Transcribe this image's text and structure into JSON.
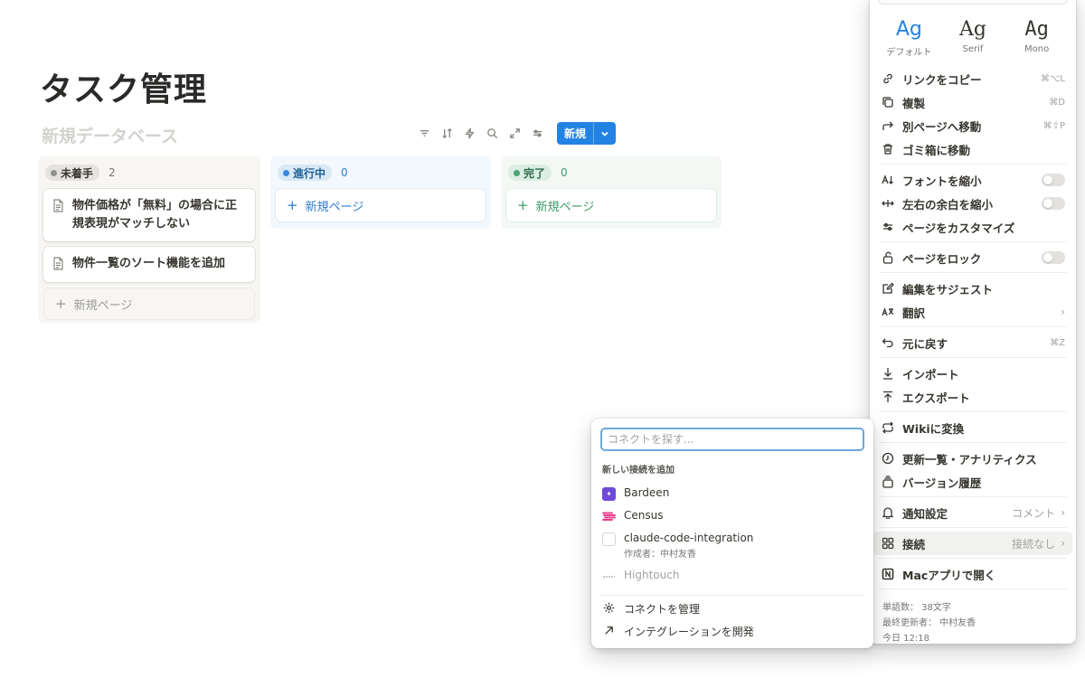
{
  "page": {
    "title": "タスク管理",
    "db_title": "新規データベース"
  },
  "toolbar": {
    "new_label": "新規"
  },
  "board": {
    "columns": [
      {
        "status": "未着手",
        "count": "2",
        "cards": [
          "物件価格が「無料」の場合に正規表現がマッチしない",
          "物件一覧のソート機能を追加"
        ],
        "add_label": "新規ページ"
      },
      {
        "status": "進行中",
        "count": "0",
        "add_label": "新規ページ"
      },
      {
        "status": "完了",
        "count": "0",
        "add_label": "新規ページ"
      }
    ]
  },
  "menu": {
    "fonts": [
      {
        "sample": "Ag",
        "label": "デフォルト"
      },
      {
        "sample": "Ag",
        "label": "Serif"
      },
      {
        "sample": "Ag",
        "label": "Mono"
      }
    ],
    "copy_link": {
      "label": "リンクをコピー",
      "shortcut": "⌘⌥L"
    },
    "duplicate": {
      "label": "複製",
      "shortcut": "⌘D"
    },
    "move_to": {
      "label": "別ページへ移動",
      "shortcut": "⌘⇧P"
    },
    "trash": {
      "label": "ゴミ箱に移動"
    },
    "small_text": {
      "label": "フォントを縮小"
    },
    "full_width": {
      "label": "左右の余白を縮小"
    },
    "customize": {
      "label": "ページをカスタマイズ"
    },
    "lock": {
      "label": "ページをロック"
    },
    "suggest": {
      "label": "編集をサジェスト"
    },
    "translate": {
      "label": "翻訳"
    },
    "undo": {
      "label": "元に戻す",
      "shortcut": "⌘Z"
    },
    "import": {
      "label": "インポート"
    },
    "export": {
      "label": "エクスポート"
    },
    "wiki": {
      "label": "Wikiに変換"
    },
    "analytics": {
      "label": "更新一覧・アナリティクス"
    },
    "history": {
      "label": "バージョン履歴"
    },
    "notify": {
      "label": "通知設定",
      "value": "コメント"
    },
    "connections": {
      "label": "接続",
      "value": "接続なし"
    },
    "mac_app": {
      "label": "Macアプリで開く"
    },
    "footer": {
      "words": "単語数： 38文字",
      "last_edited": "最終更新者： 中村友香",
      "time": "今日 12:18"
    }
  },
  "connect_popup": {
    "search_placeholder": "コネクトを探す...",
    "section_label": "新しい接続を追加",
    "items": [
      {
        "name": "Bardeen"
      },
      {
        "name": "Census"
      },
      {
        "name": "claude-code-integration",
        "sub": "作成者：中村友香"
      },
      {
        "name": "Hightouch"
      }
    ],
    "manage": "コネクトを管理",
    "develop": "インテグレーションを開発"
  },
  "colors": {
    "accent": "#2383e2",
    "toggle_off": "#e2e1dd",
    "bardeen": "#6f4ad8",
    "census": "#e8408f"
  }
}
